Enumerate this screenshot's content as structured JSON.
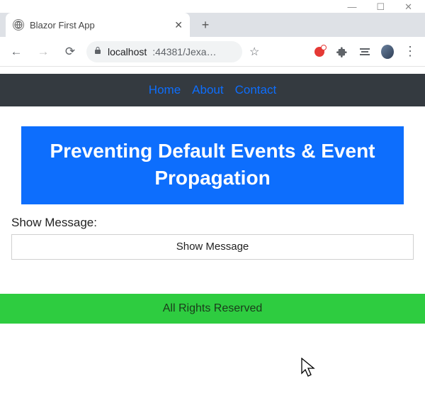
{
  "window": {
    "minimize": "—",
    "maximize": "☐",
    "close": "✕"
  },
  "tab": {
    "title": "Blazor First App",
    "close": "✕"
  },
  "newtab": "+",
  "toolbar": {
    "back": "←",
    "forward": "→",
    "reload": "⟳",
    "lock": "🔒",
    "url_host": "localhost",
    "url_port_path": ":44381/Jexa…",
    "star": "☆",
    "kebab": "⋮"
  },
  "nav": {
    "home": "Home",
    "about": "About",
    "contact": "Contact"
  },
  "banner": {
    "text": "Preventing Default Events & Event Propagation"
  },
  "form": {
    "label": "Show Message:",
    "button": "Show Message"
  },
  "footer": {
    "text": "All Rights Reserved"
  },
  "colors": {
    "accent": "#0d6efd",
    "navbar": "#343a40",
    "footer": "#2ecc40"
  }
}
